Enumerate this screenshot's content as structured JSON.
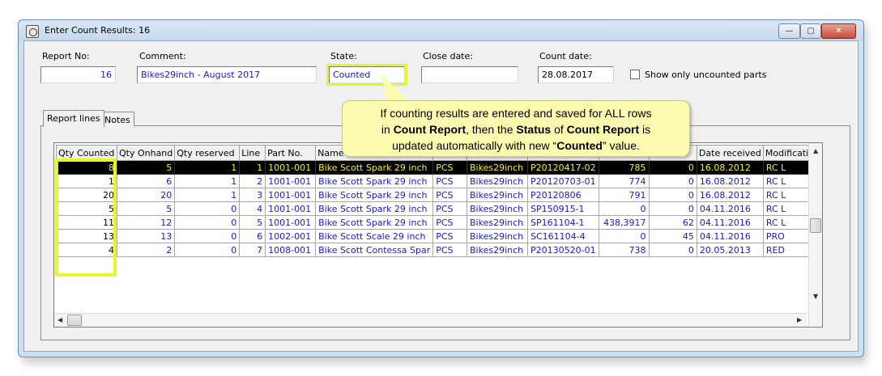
{
  "window": {
    "title": "Enter Count Results: 16",
    "min_symbol": "—",
    "max_symbol": "▢",
    "close_symbol": "✕"
  },
  "header": {
    "report_no_label": "Report No:",
    "report_no_value": "16",
    "comment_label": "Comment:",
    "comment_value": "Bikes29inch - August 2017",
    "state_label": "State:",
    "state_value": "Counted",
    "close_date_label": "Close date:",
    "close_date_value": "",
    "count_date_label": "Count date:",
    "count_date_value": "28.08.2017",
    "show_uncounted_label": "Show only uncounted parts"
  },
  "tabs": [
    {
      "label": "Report lines"
    },
    {
      "label": "Notes"
    }
  ],
  "callout": {
    "p1": "If counting results are entered and saved for ALL rows",
    "p2": "in ",
    "b1": "Count Report",
    "p3": ", then the ",
    "b2": "Status",
    "p4": " of ",
    "b3": "Count Report",
    "p5": " is",
    "p6": "updated automatically with new “",
    "b4": "Counted",
    "p7": "” value."
  },
  "table": {
    "columns": [
      "Qty Counted",
      "Qty Onhand",
      "Qty reserved",
      "Line",
      "Part No.",
      "Name",
      "",
      "",
      "",
      "",
      "",
      "Date received",
      "Modification"
    ],
    "rows": [
      [
        "8",
        "5",
        "1",
        "1",
        "1001-001",
        "Bike Scott Spark 29 inch",
        "PCS",
        "Bikes29inch",
        "P20120417-02",
        "785",
        "0",
        "16.08.2012",
        "RC L"
      ],
      [
        "1",
        "6",
        "1",
        "2",
        "1001-001",
        "Bike Scott Spark 29 inch",
        "PCS",
        "Bikes29inch",
        "P20120703-01",
        "774",
        "0",
        "16.08.2012",
        "RC L"
      ],
      [
        "20",
        "20",
        "1",
        "3",
        "1001-001",
        "Bike Scott Spark 29 inch",
        "PCS",
        "Bikes29inch",
        "P20120806",
        "791",
        "0",
        "16.08.2012",
        "RC L"
      ],
      [
        "5",
        "5",
        "0",
        "4",
        "1001-001",
        "Bike Scott Spark 29 inch",
        "PCS",
        "Bikes29inch",
        "SP150915-1",
        "0",
        "0",
        "04.11.2016",
        "RC L"
      ],
      [
        "11",
        "12",
        "0",
        "5",
        "1001-001",
        "Bike Scott Spark 29 inch",
        "PCS",
        "Bikes29inch",
        "SP161104-1",
        "438,3917",
        "62",
        "04.11.2016",
        "RC L"
      ],
      [
        "13",
        "13",
        "0",
        "6",
        "1002-001",
        "Bike Scott Scale 29 inch",
        "PCS",
        "Bikes29inch",
        "SC161104-4",
        "0",
        "45",
        "04.11.2016",
        "PRO"
      ],
      [
        "4",
        "2",
        "0",
        "7",
        "1008-001",
        "Bike Scott Contessa Spar",
        "PCS",
        "Bikes29inch",
        "P20130520-01",
        "738",
        "0",
        "20.05.2013",
        "RED"
      ]
    ]
  },
  "colors": {
    "highlight": "#e6f52c",
    "callout_bg": "#fdfbb0",
    "cell_text": "#1a1ad0",
    "selected_text": "#f6f30c"
  }
}
